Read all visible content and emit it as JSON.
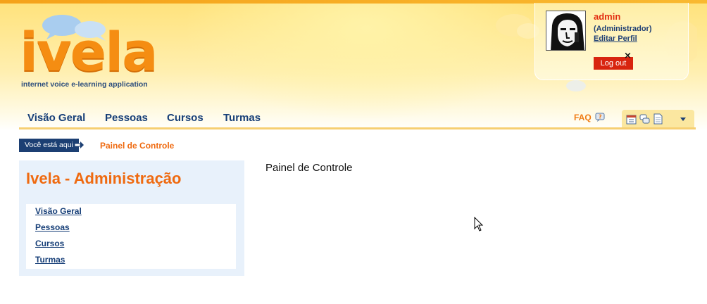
{
  "logo": {
    "word": "ivela",
    "tagline": "internet voice e-learning application"
  },
  "user": {
    "name": "admin",
    "role": "(Administrador)",
    "edit_profile": "Editar Perfil",
    "logout": "Log out",
    "logout_close": "×"
  },
  "nav": {
    "items": [
      "Visão Geral",
      "Pessoas",
      "Cursos",
      "Turmas"
    ],
    "faq": "FAQ"
  },
  "toolbar": {
    "icons": [
      "calendar-icon",
      "chat-icon",
      "document-icon",
      "chevron-down-icon"
    ]
  },
  "breadcrumb": {
    "label": "Você está aqui",
    "current": "Painel de Controle"
  },
  "sidebar": {
    "title": "Ivela - Administração",
    "links": [
      "Visão Geral",
      "Pessoas",
      "Cursos",
      "Turmas"
    ]
  },
  "main": {
    "title": "Painel de Controle"
  },
  "colors": {
    "accent_orange": "#ef6a10",
    "nav_blue": "#173f78",
    "logout_red": "#d8240f",
    "sidebar_bg": "#e8f1fb"
  }
}
